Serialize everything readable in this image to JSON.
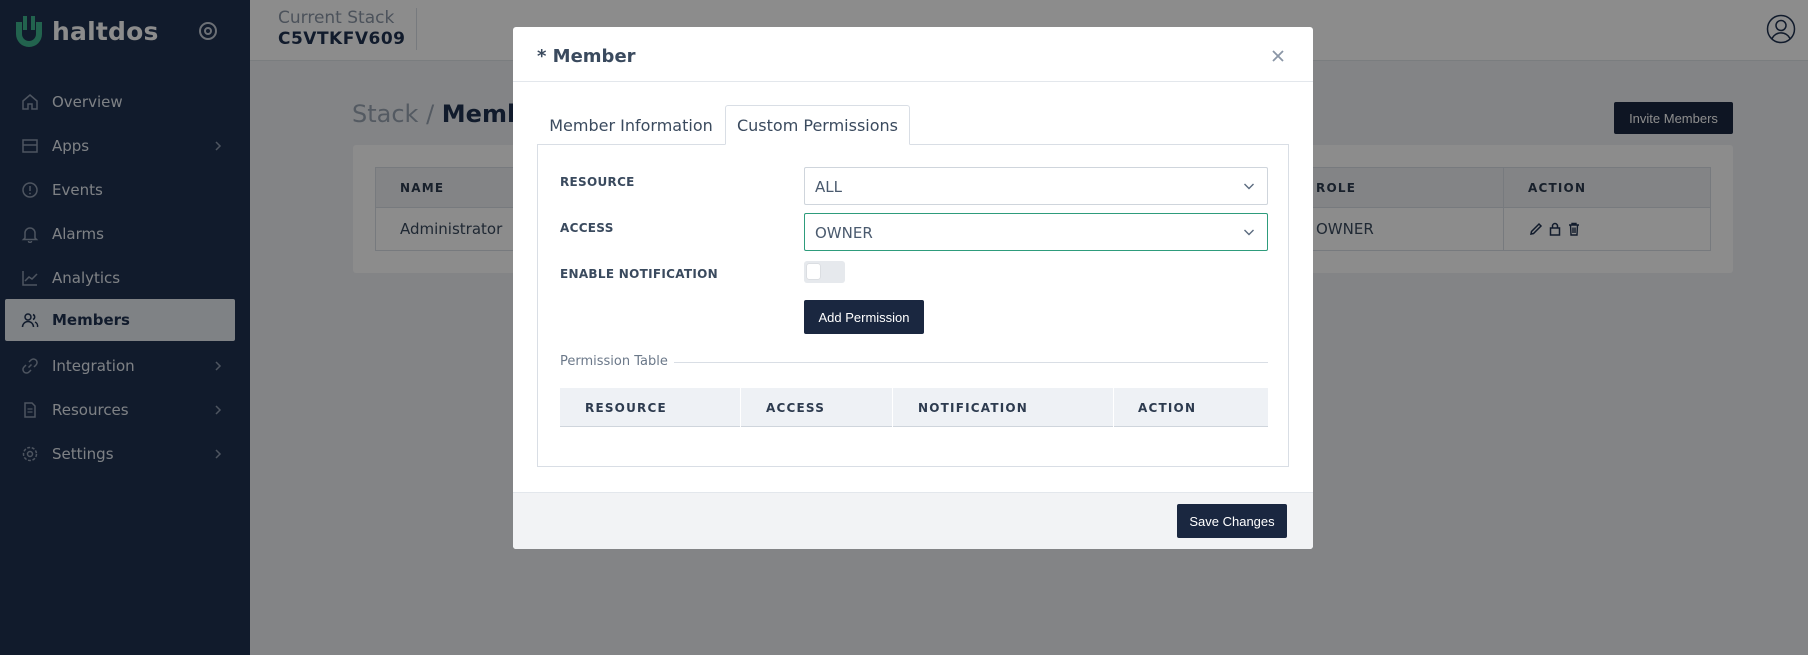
{
  "brand": {
    "name": "haltdos"
  },
  "topbar": {
    "stack_caption": "Current Stack",
    "stack_id": "C5VTKFV609"
  },
  "sidebar": {
    "items": [
      {
        "label": "Overview",
        "icon": "home-icon",
        "has_submenu": false,
        "active": false
      },
      {
        "label": "Apps",
        "icon": "grid-icon",
        "has_submenu": true,
        "active": false
      },
      {
        "label": "Events",
        "icon": "alert-circle-icon",
        "has_submenu": false,
        "active": false
      },
      {
        "label": "Alarms",
        "icon": "bell-icon",
        "has_submenu": false,
        "active": false
      },
      {
        "label": "Analytics",
        "icon": "line-chart-icon",
        "has_submenu": false,
        "active": false
      },
      {
        "label": "Members",
        "icon": "users-icon",
        "has_submenu": false,
        "active": true
      },
      {
        "label": "Integration",
        "icon": "link-icon",
        "has_submenu": true,
        "active": false
      },
      {
        "label": "Resources",
        "icon": "file-icon",
        "has_submenu": true,
        "active": false
      },
      {
        "label": "Settings",
        "icon": "gear-icon",
        "has_submenu": true,
        "active": false
      }
    ]
  },
  "page": {
    "breadcrumb_root": "Stack / ",
    "breadcrumb_current": "Member",
    "invite_label": "Invite Members",
    "table": {
      "headers": {
        "name": "NAME",
        "role": "ROLE",
        "action": "ACTION"
      },
      "rows": [
        {
          "name": "Administrator",
          "role": "OWNER"
        }
      ]
    }
  },
  "modal": {
    "title": "* Member",
    "tabs": [
      {
        "label": "Member Information",
        "active": false
      },
      {
        "label": "Custom Permissions",
        "active": true
      }
    ],
    "form": {
      "resource_label": "RESOURCE",
      "resource_value": "ALL",
      "access_label": "ACCESS",
      "access_value": "OWNER",
      "notification_label": "ENABLE NOTIFICATION",
      "notification_enabled": false,
      "add_permission_label": "Add Permission"
    },
    "permission_table": {
      "legend": "Permission Table",
      "headers": {
        "resource": "RESOURCE",
        "access": "ACCESS",
        "notification": "NOTIFICATION",
        "action": "ACTION"
      },
      "rows": []
    },
    "save_label": "Save Changes"
  },
  "colors": {
    "sidebar": "#1f3250",
    "accent": "#2e9c7c",
    "primary_button": "#1a2740"
  }
}
